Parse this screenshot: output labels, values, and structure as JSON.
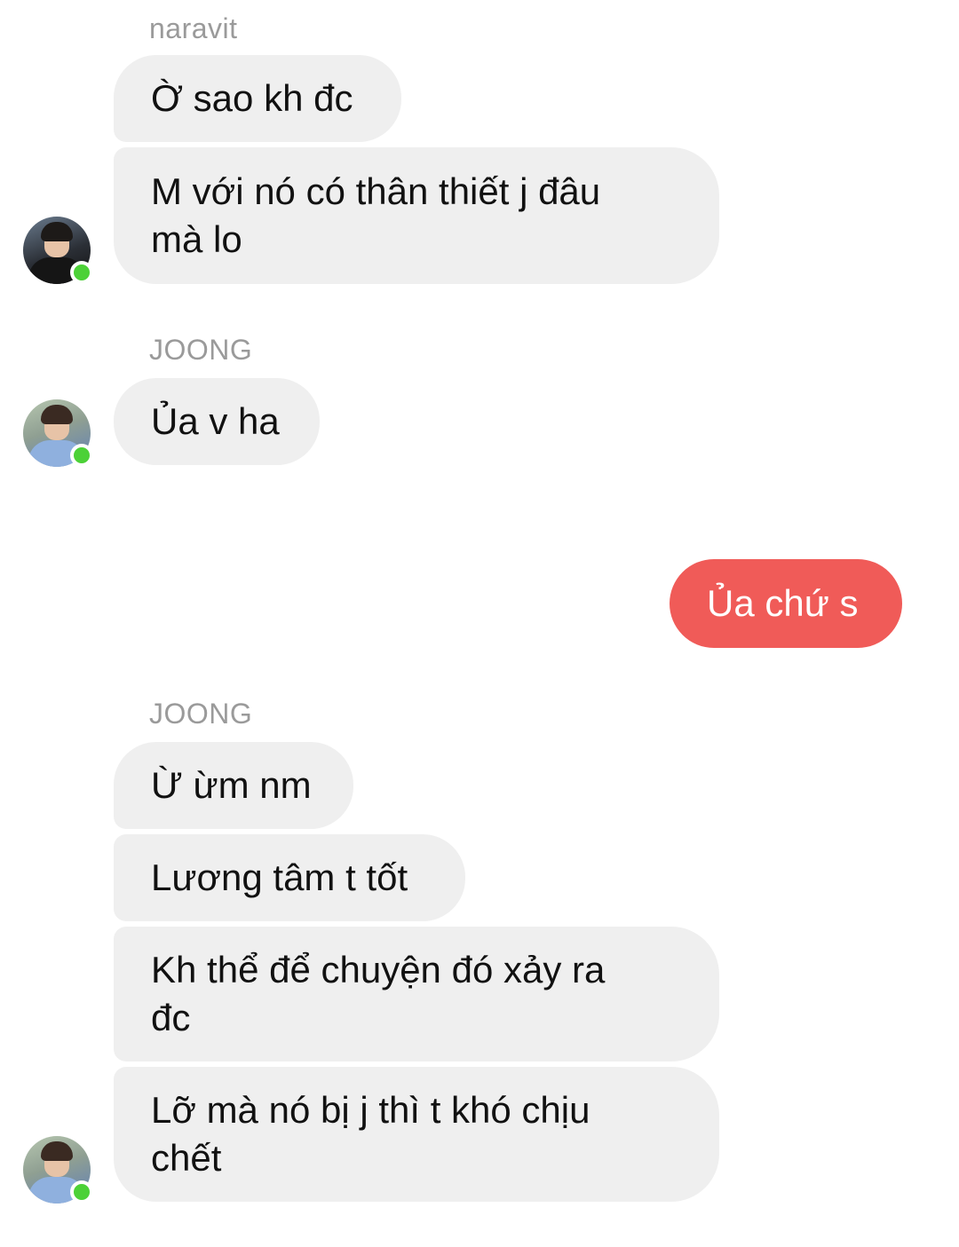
{
  "conversation": {
    "group1": {
      "sender": "naravit",
      "messages": [
        "Ờ sao kh đc",
        "M với nó có thân thiết j đâu\nmà lo"
      ]
    },
    "group2": {
      "sender": "JOONG",
      "messages": [
        "Ủa v ha"
      ]
    },
    "outgoing": {
      "messages": [
        "Ủa chứ s"
      ]
    },
    "group3": {
      "sender": "JOONG",
      "messages": [
        "Ừ ừm nm",
        "Lương tâm t tốt",
        "Kh thể để chuyện đó xảy ra\nđc",
        "Lỡ mà nó bị j thì t khó chịu\nchết"
      ]
    }
  },
  "colors": {
    "incoming_bubble": "#efefef",
    "outgoing_bubble": "#f05b58",
    "sender_name": "#9a9a9a",
    "online_dot": "#4cd137"
  }
}
